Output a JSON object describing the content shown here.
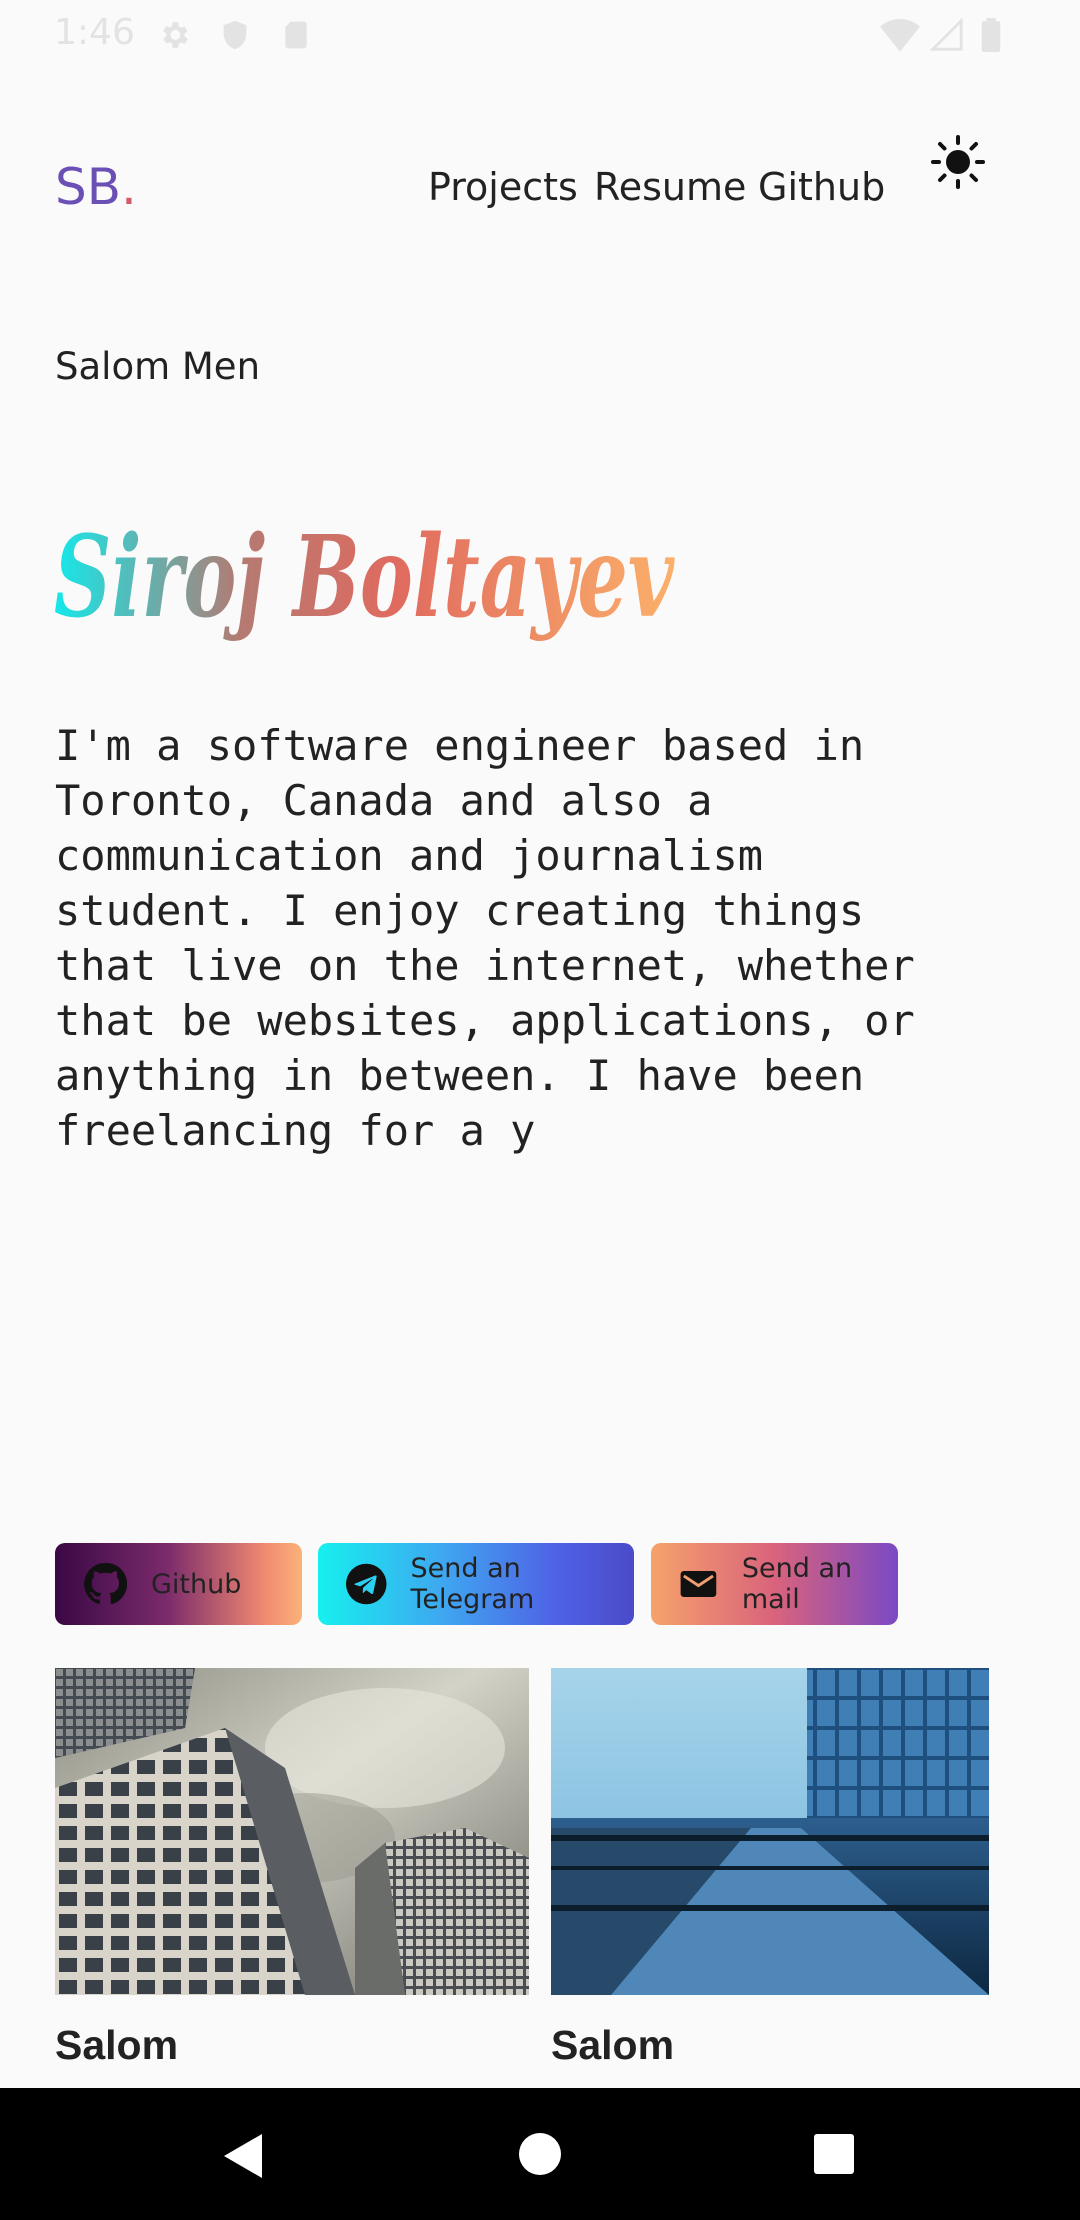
{
  "status": {
    "time": "1:46"
  },
  "header": {
    "logo_main": "SB",
    "logo_dot": ".",
    "nav": [
      "Projects",
      "Resume",
      "Github"
    ],
    "theme_icon": "sun-icon"
  },
  "subtitle": "Salom Men",
  "hero_name": "Siroj Boltayev",
  "bio": "I'm a software engineer based in\nToronto, Canada and also a\ncommunication and journalism\nstudent. I enjoy creating things\nthat live on the internet, whether\nthat be websites, applications, or\nanything in between. I have been\nfreelancing for a y",
  "buttons": [
    {
      "label": "Github",
      "icon": "github-icon"
    },
    {
      "label": "Send an Telegram",
      "icon": "telegram-icon"
    },
    {
      "label": "Send an mail",
      "icon": "mail-icon"
    }
  ],
  "cards": [
    {
      "title": "Salom"
    },
    {
      "title": "Salom"
    }
  ],
  "colors": {
    "background": "#fafafa",
    "hero_gradient": [
      "#14e8ea",
      "#c5605f",
      "#f07a5a",
      "#fbb06a"
    ]
  }
}
